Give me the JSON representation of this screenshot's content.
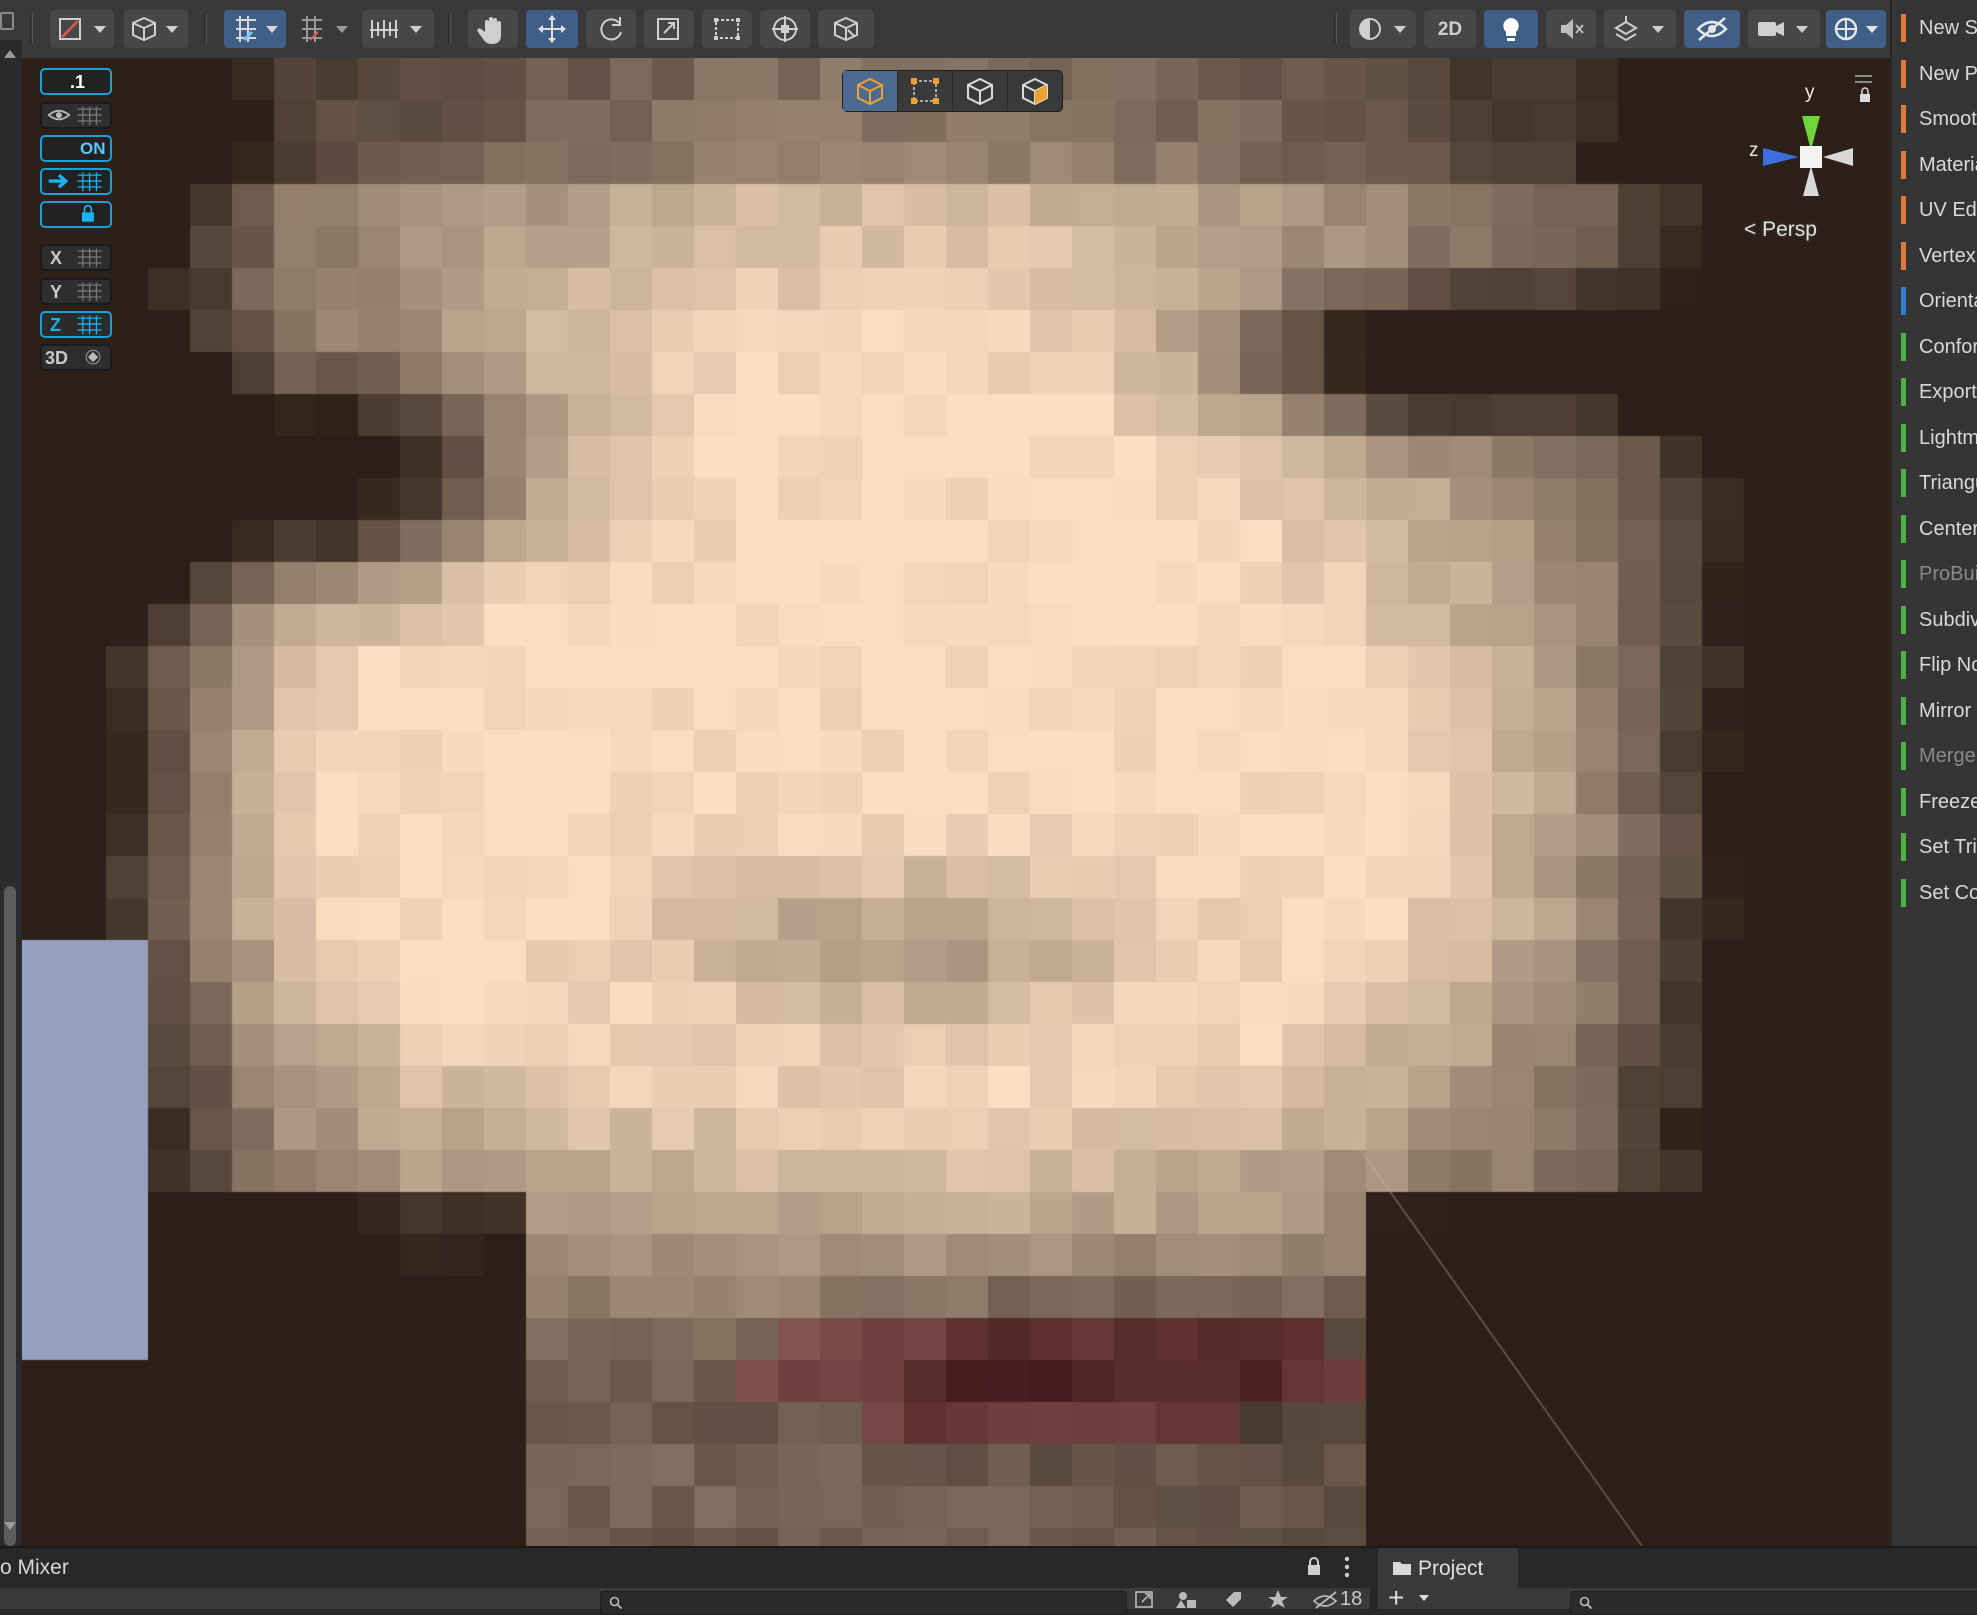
{
  "toolbar": {
    "left_tools": [
      "draw-tool-icon",
      "cube-tool-icon",
      "grid-snap-icon",
      "increment-snap-icon",
      "align-icon"
    ],
    "transform_tools": [
      "hand-icon",
      "move-icon",
      "rotate-icon",
      "scale-icon",
      "rect-icon",
      "transform-icon",
      "custom-tool-icon"
    ],
    "right_tools": {
      "two_d_label": "2D"
    }
  },
  "probuilder_panel": {
    "grid_size": ".1",
    "toggle_on": "ON",
    "axis_x": "X",
    "axis_y": "Y",
    "axis_z": "Z",
    "three_d": "3D"
  },
  "gizmo": {
    "y_label": "y",
    "z_label": "z",
    "persp_label": "Persp"
  },
  "right_panel": {
    "items": [
      {
        "label": "New Shape",
        "color": "#e07a3b",
        "enabled": true
      },
      {
        "label": "New Poly Shape",
        "color": "#e07a3b",
        "enabled": true
      },
      {
        "label": "Smoothing",
        "color": "#e07a3b",
        "enabled": true
      },
      {
        "label": "Material Editor",
        "color": "#e07a3b",
        "enabled": true
      },
      {
        "label": "UV Editor",
        "color": "#e07a3b",
        "enabled": true
      },
      {
        "label": "Vertex Colors",
        "color": "#e07a3b",
        "enabled": true
      },
      {
        "label": "Orientation",
        "color": "#2f7fd1",
        "enabled": true
      },
      {
        "label": "Conform Normals",
        "color": "#4db342",
        "enabled": true
      },
      {
        "label": "Export",
        "color": "#4db342",
        "enabled": true
      },
      {
        "label": "Lightmap UVs",
        "color": "#4db342",
        "enabled": true
      },
      {
        "label": "Triangulate",
        "color": "#4db342",
        "enabled": true
      },
      {
        "label": "Center Pivot",
        "color": "#4db342",
        "enabled": true
      },
      {
        "label": "ProBuilderize",
        "color": "#4db342",
        "enabled": false
      },
      {
        "label": "Subdivide",
        "color": "#4db342",
        "enabled": true
      },
      {
        "label": "Flip Normals",
        "color": "#4db342",
        "enabled": true
      },
      {
        "label": "Mirror Objects",
        "color": "#4db342",
        "enabled": true
      },
      {
        "label": "Merge Objects",
        "color": "#4db342",
        "enabled": false
      },
      {
        "label": "Freeze Transform",
        "color": "#4db342",
        "enabled": true
      },
      {
        "label": "Set Trigger",
        "color": "#4db342",
        "enabled": true
      },
      {
        "label": "Set Collider",
        "color": "#4db342",
        "enabled": true
      }
    ]
  },
  "bottom": {
    "audio_mixer_tab": "o Mixer",
    "hidden_count": "18",
    "project_tab": "Project",
    "add_label": "+"
  }
}
